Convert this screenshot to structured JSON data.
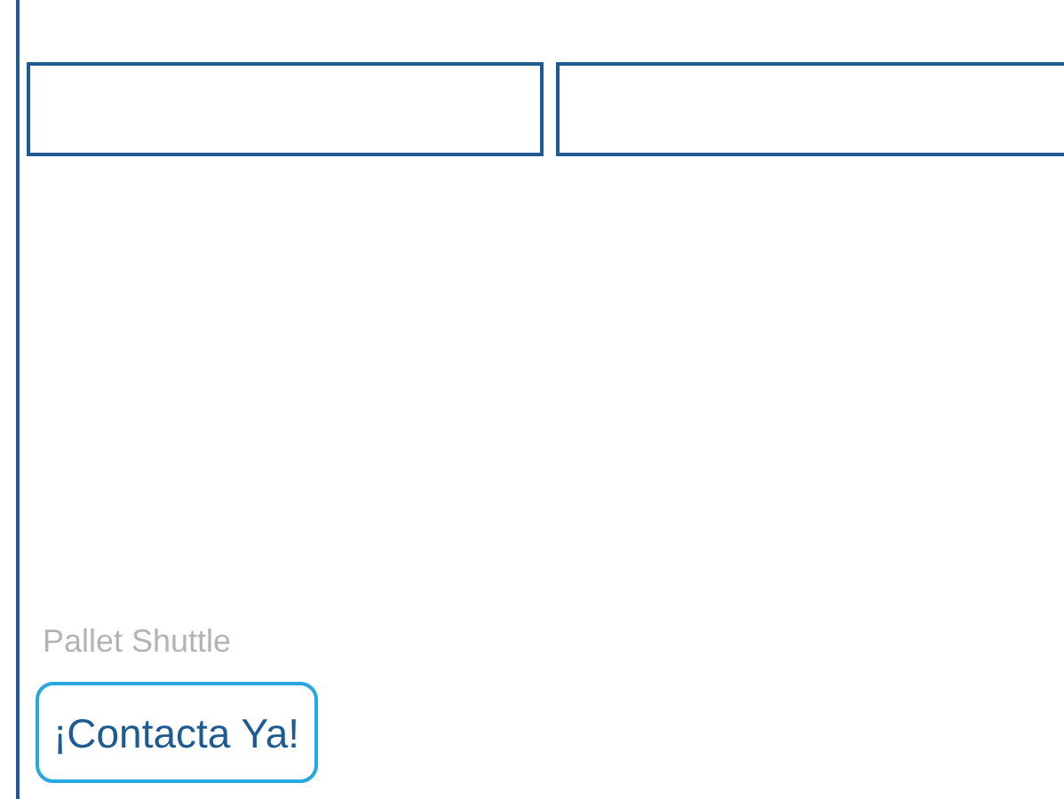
{
  "caption": "Pallet Shuttle",
  "button": {
    "label": "¡Contacta Ya!"
  }
}
